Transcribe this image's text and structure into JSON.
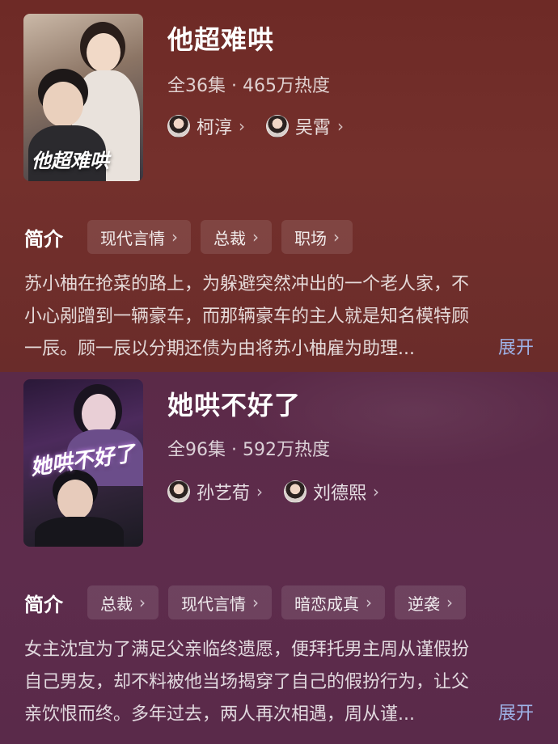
{
  "dramas": [
    {
      "title": "他超难哄",
      "poster_title": "他超难哄",
      "meta": "全36集 · 465万热度",
      "cast": [
        {
          "name": "柯淳"
        },
        {
          "name": "吴霄"
        }
      ],
      "intro_label": "简介",
      "tags": [
        "现代言情",
        "总裁",
        "职场"
      ],
      "synopsis_lines": [
        "苏小柚在抢菜的路上，为躲避突然冲出的一个老人家，不",
        "小心剐蹭到一辆豪车，而那辆豪车的主人就是知名模特顾",
        "一辰。顾一辰以分期还债为由将苏小柚雇为助理..."
      ],
      "expand_label": "展开"
    },
    {
      "title": "她哄不好了",
      "poster_title": "她哄不好了",
      "meta": "全96集 · 592万热度",
      "cast": [
        {
          "name": "孙艺荀"
        },
        {
          "name": "刘德熙"
        }
      ],
      "intro_label": "简介",
      "tags": [
        "总裁",
        "现代言情",
        "暗恋成真",
        "逆袭"
      ],
      "synopsis_lines": [
        "女主沈宜为了满足父亲临终遗愿，便拜托男主周从谨假扮",
        "自己男友，却不料被他当场揭穿了自己的假扮行为，让父",
        "亲饮恨而终。多年过去，两人再次相遇，周从谨..."
      ],
      "expand_label": "展开"
    }
  ],
  "icons": {
    "chevron": "chevron-right-icon"
  },
  "colors": {
    "first_bg": "#6e2a26",
    "second_bg": "#5b2a48",
    "expand_link": "#9fb3e8"
  }
}
